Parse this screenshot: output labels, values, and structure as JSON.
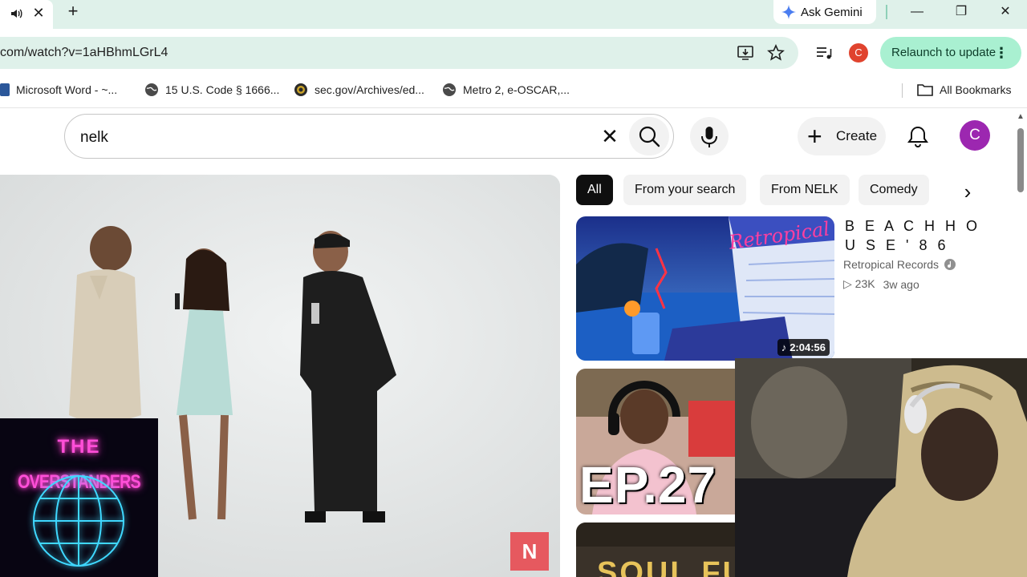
{
  "browser": {
    "tab_close_glyph": "✕",
    "new_tab_glyph": "+",
    "ask_gemini_label": "Ask Gemini",
    "window_buttons": {
      "minimize": "—",
      "restore": "❐",
      "close": "✕"
    },
    "url": "com/watch?v=1aHBhmLGrL4",
    "profile_initial": "C",
    "relaunch_label": "Relaunch to update",
    "bookmarks": [
      {
        "label": "Microsoft Word - ~...",
        "icon": "word-doc-icon"
      },
      {
        "label": "15 U.S. Code § 1666...",
        "icon": "globe-icon"
      },
      {
        "label": "sec.gov/Archives/ed...",
        "icon": "sec-seal-icon"
      },
      {
        "label": "Metro 2, e-OSCAR,...",
        "icon": "globe-icon"
      }
    ],
    "all_bookmarks_label": "All Bookmarks"
  },
  "youtube": {
    "search_query": "nelk",
    "clear_glyph": "✕",
    "create_label": "Create",
    "avatar_initial": "C",
    "chips": [
      "All",
      "From your search",
      "From NELK",
      "Comedy"
    ],
    "chip_next_glyph": "›",
    "player_badge": "N",
    "recommendations": [
      {
        "title": "B E A C H H O U S E ' 8 6",
        "channel": "Retropical Records",
        "views": "23K",
        "age": "3w ago",
        "duration": "2:04:56",
        "thumb_text": "Retropical"
      },
      {
        "thumb_text": "EP.27"
      },
      {
        "thumb_text": "SOUL FU"
      }
    ]
  },
  "overlay": {
    "logo_line1": "THE",
    "logo_line2": "OVERSTANDERS"
  },
  "colors": {
    "chrome_tint": "#dff1ea",
    "relaunch_bg": "#a9f0d1",
    "avatar_bg": "#9c27b0",
    "profile_dot": "#e0432e",
    "neon_pink": "#ff4fd8",
    "neon_blue": "#3fd8ff"
  }
}
